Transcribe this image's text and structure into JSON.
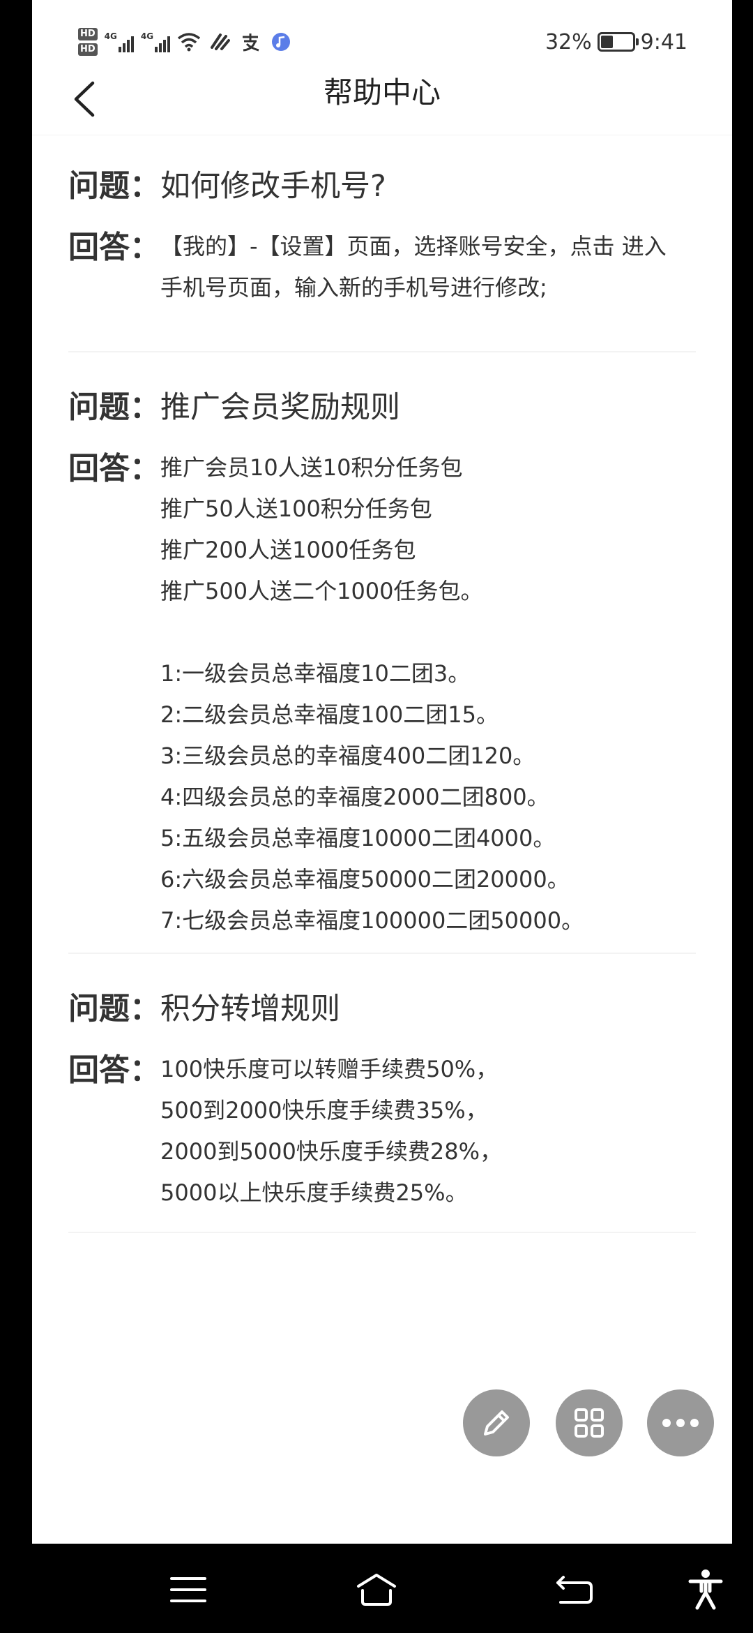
{
  "status_bar": {
    "hd1": "HD",
    "hd2": "HD",
    "network1": "4G",
    "network2": "4G",
    "battery_percent": "32%",
    "time": "9:41",
    "icons": [
      "hd-icon",
      "signal-icon",
      "wifi-icon",
      "vibrate-icon",
      "alipay-icon",
      "music-icon",
      "battery-icon"
    ]
  },
  "header": {
    "title": "帮助中心",
    "back_icon": "chevron-left-icon"
  },
  "faqs": [
    {
      "question_label": "问题：",
      "question": "如何修改手机号?",
      "answer_label": "回答：",
      "answer_lines": [
        "【我的】-【设置】页面，选择账号安全，点击 进入",
        "手机号页面，输入新的手机号进行修改;"
      ]
    },
    {
      "question_label": "问题：",
      "question": "推广会员奖励规则",
      "answer_label": "回答：",
      "answer_lines": [
        "推广会员10人送10积分任务包",
        "推广50人送100积分任务包",
        "推广200人送1000任务包",
        "推广500人送二个1000任务包。",
        "",
        "1:一级会员总幸福度10二团3。",
        "2:二级会员总幸福度100二团15。",
        "3:三级会员总的幸福度400二团120。",
        "4:四级会员总的幸福度2000二团800。",
        "5:五级会员总幸福度10000二团4000。",
        "6:六级会员总幸福度50000二团20000。",
        "7:七级会员总幸福度100000二团50000。"
      ]
    },
    {
      "question_label": "问题：",
      "question": "积分转增规则",
      "answer_label": "回答：",
      "answer_lines": [
        "100快乐度可以转赠手续费50%，",
        "500到2000快乐度手续费35%，",
        "2000到5000快乐度手续费28%，",
        "5000以上快乐度手续费25%。"
      ]
    }
  ],
  "floating_actions": [
    "edit-icon",
    "grid-icon",
    "more-icon"
  ],
  "system_nav": [
    "menu-icon",
    "home-icon",
    "back-icon",
    "accessibility-icon"
  ],
  "colors": {
    "fab": "#999999",
    "text": "#333333",
    "divider": "#f3f3f3"
  }
}
